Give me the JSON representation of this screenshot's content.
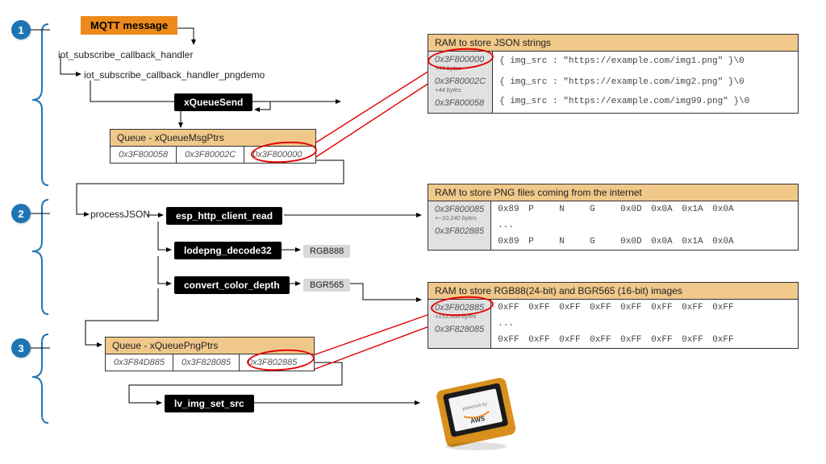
{
  "steps": [
    "1",
    "2",
    "3"
  ],
  "mqtt": "MQTT message",
  "funcs": {
    "cb": "iot_subscribe_callback_handler",
    "cbp": "iot_subscribe_callback_handler_pngdemo",
    "pj": "processJSON",
    "xqs": "xQueueSend",
    "http": "esp_http_client_read",
    "lode": "lodepng_decode32",
    "ccd": "convert_color_depth",
    "lv": "lv_img_set_src"
  },
  "tags": {
    "rgb888": "RGB888",
    "bgr565": "BGR565"
  },
  "queueMsg": {
    "title": "Queue - xQueueMsgPtrs",
    "cells": [
      "0x3F800058",
      "0x3F80002C",
      "0x3F800000"
    ]
  },
  "queuePng": {
    "title": "Queue - xQueuePngPtrs",
    "cells": [
      "0x3F84D885",
      "0x3F828085",
      "0x3F802885"
    ]
  },
  "ramJson": {
    "title": "RAM to store JSON strings",
    "rows": [
      {
        "addr": "0x3F800000",
        "sz": "+44 bytes",
        "val": "{ img_src : \"https://example.com/img1.png\" }\\0"
      },
      {
        "addr": "0x3F80002C",
        "sz": "+44 bytes",
        "val": "{ img_src : \"https://example.com/img2.png\" }\\0"
      },
      {
        "addr": "0x3F800058",
        "sz": "",
        "val": "{ img_src : \"https://example.com/img99.png\" }\\0"
      }
    ]
  },
  "ramPng": {
    "title": "RAM to store PNG files coming from the internet",
    "rows": [
      {
        "addr": "0x3F800085",
        "sz": "+~10,240 bytes",
        "cells": [
          "0x89",
          "P",
          "N",
          "G",
          "0x0D",
          "0x0A",
          "0x1A",
          "0x0A"
        ]
      },
      {
        "addr": "",
        "sz": "",
        "cells": [
          "..."
        ]
      },
      {
        "addr": "0x3F802885",
        "sz": "",
        "cells": [
          "0x89",
          "P",
          "N",
          "G",
          "0x0D",
          "0x0A",
          "0x1A",
          "0x0A"
        ]
      }
    ]
  },
  "ramRgb": {
    "title": "RAM to store RGB88(24-bit) and BGR565 (16-bit) images",
    "rows": [
      {
        "addr": "0x3F802885",
        "sz": "+153,600 bytes",
        "cells": [
          "0xFF",
          "0xFF",
          "0xFF",
          "0xFF",
          "0xFF",
          "0xFF",
          "0xFF",
          "0xFF"
        ]
      },
      {
        "addr": "",
        "sz": "",
        "cells": [
          "..."
        ]
      },
      {
        "addr": "0x3F828085",
        "sz": "",
        "cells": [
          "0xFF",
          "0xFF",
          "0xFF",
          "0xFF",
          "0xFF",
          "0xFF",
          "0xFF",
          "0xFF"
        ]
      }
    ]
  },
  "device": "powered by AWS"
}
